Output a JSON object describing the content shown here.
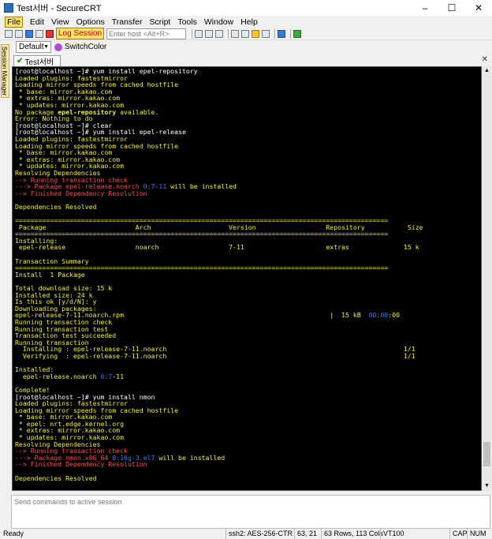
{
  "window": {
    "title": "Test서버 - SecureCRT",
    "controls": [
      "–",
      "☐",
      "✕"
    ]
  },
  "menu": [
    "File",
    "Edit",
    "View",
    "Options",
    "Transfer",
    "Script",
    "Tools",
    "Window",
    "Help"
  ],
  "toolbar": {
    "log_session": "Log Session",
    "host_placeholder": "Enter host <Alt+R>"
  },
  "button_bar": {
    "default_label": "Default",
    "switchcolor_label": "SwitchColor"
  },
  "session_manager_label": "Session Manager",
  "tab": {
    "label": "Test서버"
  },
  "terminal": {
    "lines": [
      [
        {
          "t": "[root@localhost ~]# yum install epel-repository",
          "c": "white"
        }
      ],
      [
        {
          "t": "Loaded plugins: fastestmirror"
        }
      ],
      [
        {
          "t": "Loading mirror speeds from cached hostfile"
        }
      ],
      [
        {
          "t": " * base: mirror.kakao.com"
        }
      ],
      [
        {
          "t": " * extras: mirror.kakao.com"
        }
      ],
      [
        {
          "t": " * updates: mirror.kakao.com"
        }
      ],
      [
        {
          "t": "No package "
        },
        {
          "t": "epel-repository",
          "b": true
        },
        {
          "t": " available."
        }
      ],
      [
        {
          "t": "Error: Nothing to do"
        }
      ],
      [
        {
          "t": "[root@localhost ~]# clear",
          "c": "white"
        }
      ],
      [
        {
          "t": "[root@localhost ~]# yum install epel-release",
          "c": "white"
        }
      ],
      [
        {
          "t": "Loaded plugins: fastestmirror"
        }
      ],
      [
        {
          "t": "Loading mirror speeds from cached hostfile"
        }
      ],
      [
        {
          "t": " * base: mirror.kakao.com"
        }
      ],
      [
        {
          "t": " * extras: mirror.kakao.com"
        }
      ],
      [
        {
          "t": " * updates: mirror.kakao.com"
        }
      ],
      [
        {
          "t": "Resolving Dependencies"
        }
      ],
      [
        {
          "t": "--> Running transaction check",
          "c": "red"
        }
      ],
      [
        {
          "t": "---> Package epel-release.noarch ",
          "c": "red"
        },
        {
          "t": "0:7-11",
          "c": "blue"
        },
        {
          "t": " will be installed"
        }
      ],
      [
        {
          "t": "--> Finished Dependency Resolution",
          "c": "red"
        }
      ],
      [
        {
          "t": ""
        }
      ],
      [
        {
          "t": "Dependencies Resolved"
        }
      ],
      [
        {
          "t": ""
        }
      ],
      [
        {
          "t": "================================================================================================"
        }
      ],
      [
        {
          "t": " Package                       Arch                    Version                  Repository           Size"
        }
      ],
      [
        {
          "t": "================================================================================================"
        }
      ],
      [
        {
          "t": "Installing:"
        }
      ],
      [
        {
          "t": " epel-release                  noarch                  7-11                     extras              15 k"
        }
      ],
      [
        {
          "t": ""
        }
      ],
      [
        {
          "t": "Transaction Summary"
        }
      ],
      [
        {
          "t": "================================================================================================"
        }
      ],
      [
        {
          "t": "Install  1 Package"
        }
      ],
      [
        {
          "t": ""
        }
      ],
      [
        {
          "t": "Total download size: 15 k"
        }
      ],
      [
        {
          "t": "Installed size: 24 k"
        }
      ],
      [
        {
          "t": "Is this ok [y/d/N]: y"
        }
      ],
      [
        {
          "t": "Downloading packages:"
        }
      ],
      [
        {
          "t": "epel-release-7-11.noarch.rpm                                                     |  15 kB  "
        },
        {
          "t": "00:00",
          "c": "blue"
        },
        {
          "t": ":00"
        }
      ],
      [
        {
          "t": "Running transaction check"
        }
      ],
      [
        {
          "t": "Running transaction test"
        }
      ],
      [
        {
          "t": "Transaction test succeeded"
        }
      ],
      [
        {
          "t": "Running transaction"
        }
      ],
      [
        {
          "t": "  Installing : epel-release-7-11.noarch                                                             1/1"
        }
      ],
      [
        {
          "t": "  Verifying  : epel-release-7-11.noarch                                                             1/1"
        }
      ],
      [
        {
          "t": ""
        }
      ],
      [
        {
          "t": "Installed:"
        }
      ],
      [
        {
          "t": "  epel-release.noarch "
        },
        {
          "t": "0:7",
          "c": "blue"
        },
        {
          "t": "-11"
        }
      ],
      [
        {
          "t": ""
        }
      ],
      [
        {
          "t": "Complete!"
        }
      ],
      [
        {
          "t": "[root@localhost ~]# yum install nmon",
          "c": "white"
        }
      ],
      [
        {
          "t": "Loaded plugins: fastestmirror"
        }
      ],
      [
        {
          "t": "Loading mirror speeds from cached hostfile"
        }
      ],
      [
        {
          "t": " * base: mirror.kakao.com"
        }
      ],
      [
        {
          "t": " * epel: nrt.edge.kernel.org"
        }
      ],
      [
        {
          "t": " * extras: mirror.kakao.com"
        }
      ],
      [
        {
          "t": " * updates: mirror.kakao.com"
        }
      ],
      [
        {
          "t": "Resolving Dependencies"
        }
      ],
      [
        {
          "t": "--> Running transaction check",
          "c": "red"
        }
      ],
      [
        {
          "t": "---> Package nmon.x86_64 ",
          "c": "red"
        },
        {
          "t": "0:16g-3.el7",
          "c": "blue"
        },
        {
          "t": " will be installed"
        }
      ],
      [
        {
          "t": "--> Finished Dependency Resolution",
          "c": "red"
        }
      ],
      [
        {
          "t": ""
        }
      ],
      [
        {
          "t": "Dependencies Resolved"
        }
      ],
      [
        {
          "t": ""
        }
      ],
      [
        {
          "t": "================================================================================================"
        }
      ]
    ]
  },
  "scrollbar": {
    "position_fraction": 0.96,
    "visible_fraction": 0.06
  },
  "command_window": {
    "placeholder": "Send commands to active session"
  },
  "status": {
    "ready": "Ready",
    "cipher": "ssh2: AES-256-CTR",
    "cursor": "63,  21",
    "size": "63 Rows, 113 Cols",
    "emulation": "VT100",
    "cap": "CAP",
    "num": "NUM"
  }
}
